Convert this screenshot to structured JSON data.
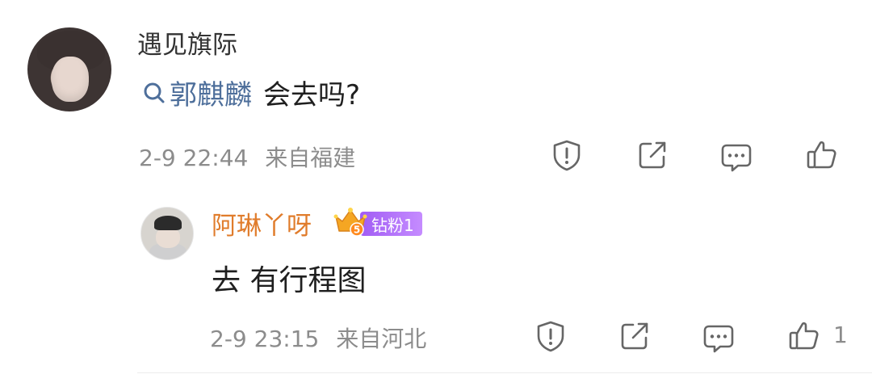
{
  "comment": {
    "username": "遇见旗际",
    "topic_icon": "search-icon",
    "topic": "郭麒麟",
    "text": "会去吗?",
    "timestamp": "2-9 22:44",
    "location": "来自福建",
    "actions": [
      "report-icon",
      "share-icon",
      "comment-icon",
      "like-icon"
    ]
  },
  "reply": {
    "username": "阿琳丫呀",
    "badge_level": "5",
    "fan_badge": "钻粉1",
    "text": "去 有行程图",
    "timestamp": "2-9 23:15",
    "location": "来自河北",
    "like_count": "1",
    "actions": [
      "report-icon",
      "share-icon",
      "comment-icon",
      "like-icon"
    ]
  },
  "colors": {
    "topic": "#4e6f9b",
    "reply_username": "#e07c2b",
    "fan_badge": "#a15cf4",
    "meta": "#8c8c8c"
  }
}
